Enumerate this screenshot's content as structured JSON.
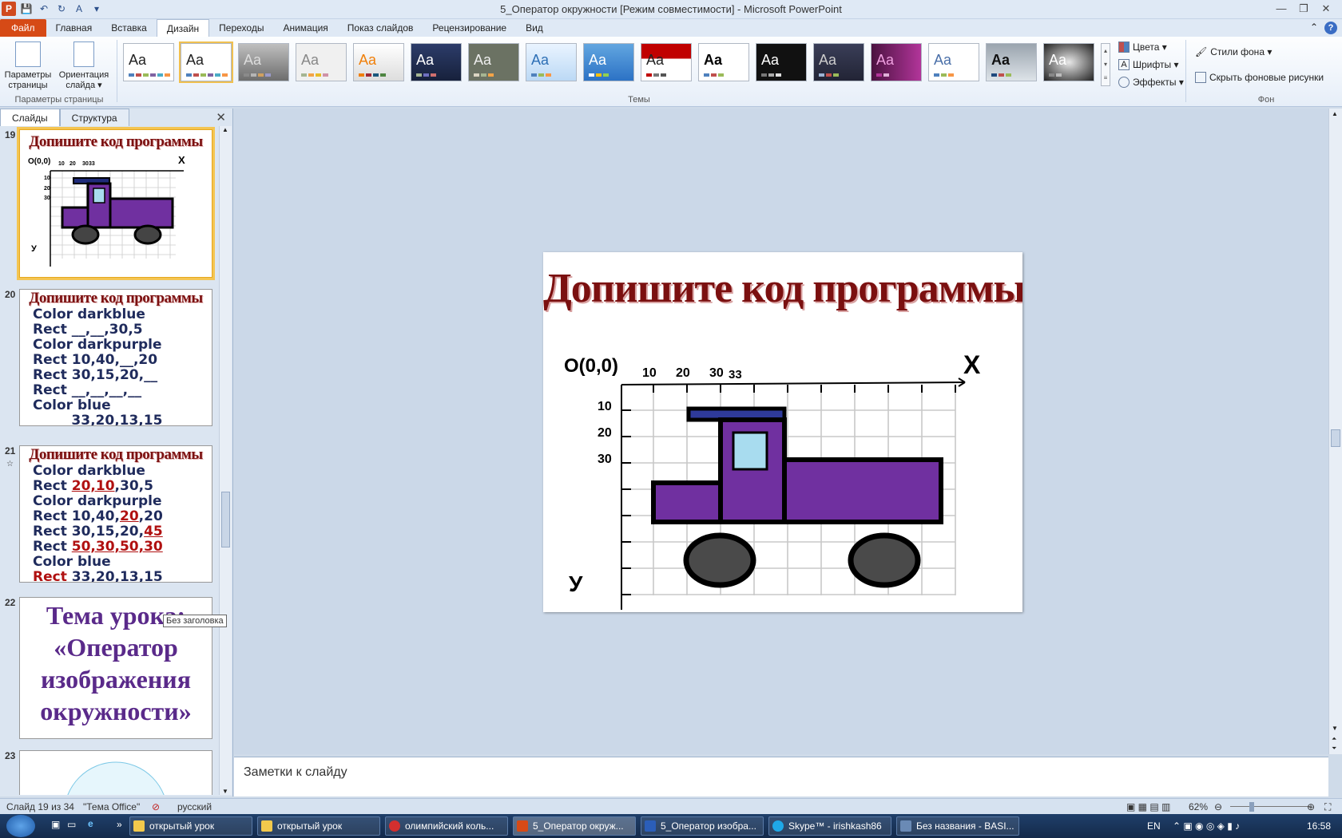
{
  "window": {
    "title": "5_Оператор окружности [Режим совместимости] - Microsoft PowerPoint"
  },
  "ribbon_tabs": [
    {
      "label": "Файл"
    },
    {
      "label": "Главная"
    },
    {
      "label": "Вставка"
    },
    {
      "label": "Дизайн"
    },
    {
      "label": "Переходы"
    },
    {
      "label": "Анимация"
    },
    {
      "label": "Показ слайдов"
    },
    {
      "label": "Рецензирование"
    },
    {
      "label": "Вид"
    }
  ],
  "active_tab": "Дизайн",
  "ribbon": {
    "page_setup_label": "Параметры страницы",
    "page_setup_button": "Параметры страницы",
    "orientation_button": "Ориентация слайда ▾",
    "themes_group": "Темы",
    "theme_sample": "Aa",
    "colors": "Цвета ▾",
    "fonts": "Шрифты ▾",
    "effects": "Эффекты ▾",
    "bg_styles": "Стили фона ▾",
    "hide_bg": "Скрыть фоновые рисунки",
    "bg_group": "Фон"
  },
  "pane": {
    "tab_slides": "Слайды",
    "tab_outline": "Структура",
    "close": "✕",
    "tooltip": "Без заголовка"
  },
  "thumbnails": {
    "s19": {
      "num": "19",
      "title": "Допишите код программы",
      "origin": "O(0,0)",
      "x": "X",
      "y": "У",
      "ticks_x": [
        "10",
        "20",
        "30",
        "33"
      ],
      "ticks_y": [
        "10",
        "20",
        "30"
      ]
    },
    "s20": {
      "num": "20",
      "title": "Допишите код программы",
      "lines": [
        "Color darkblue",
        "Rect __,__,30,5",
        "Color darkpurple",
        "Rect 10,40,__,20",
        "Rect 30,15,20,__",
        "Rect __,__,__,__",
        "Color blue",
        "_____ 33,20,13,15"
      ]
    },
    "s21": {
      "num": "21",
      "star": "☆",
      "title": "Допишите код программы",
      "l1": "Color darkblue",
      "l2a": "Rect ",
      "l2b": "20,10",
      "l2c": ",30,5",
      "l3": "Color darkpurple",
      "l4a": "Rect 10,40,",
      "l4b": "20",
      "l4c": ",20",
      "l5a": "Rect 30,15,20,",
      "l5b": "45",
      "l6a": "Rect ",
      "l6b": "50,30,50,30",
      "l7": "Color blue",
      "l8a": "Rect",
      "l8b": " 33,20,13,15"
    },
    "s22": {
      "num": "22",
      "text": "Тема урока: «Оператор изображения окружности»"
    },
    "s23": {
      "num": "23"
    }
  },
  "slide": {
    "title": "Допишите код программы",
    "origin": "O(0,0)",
    "x_axis": "X",
    "y_axis": "У",
    "ticks_x": [
      "10",
      "20",
      "30",
      "33"
    ],
    "ticks_y": [
      "10",
      "20",
      "30"
    ]
  },
  "notes": {
    "placeholder": "Заметки к слайду"
  },
  "status": {
    "slide": "Слайд 19 из 34",
    "theme": "\"Тема Office\"",
    "lang": "русский",
    "zoom": "62%"
  },
  "taskbar": {
    "items": [
      "открытый урок",
      "открытый урок",
      "олимпийский коль...",
      "5_Оператор окруж...",
      "5_Оператор изобра...",
      "Skype™ - irishkash86",
      "Без названия - BASI..."
    ],
    "lang": "EN",
    "time": "16:58"
  },
  "colors": {
    "accent": "#d64a16",
    "slide_title": "#7b1010",
    "truck_purple": "#7030a0"
  }
}
